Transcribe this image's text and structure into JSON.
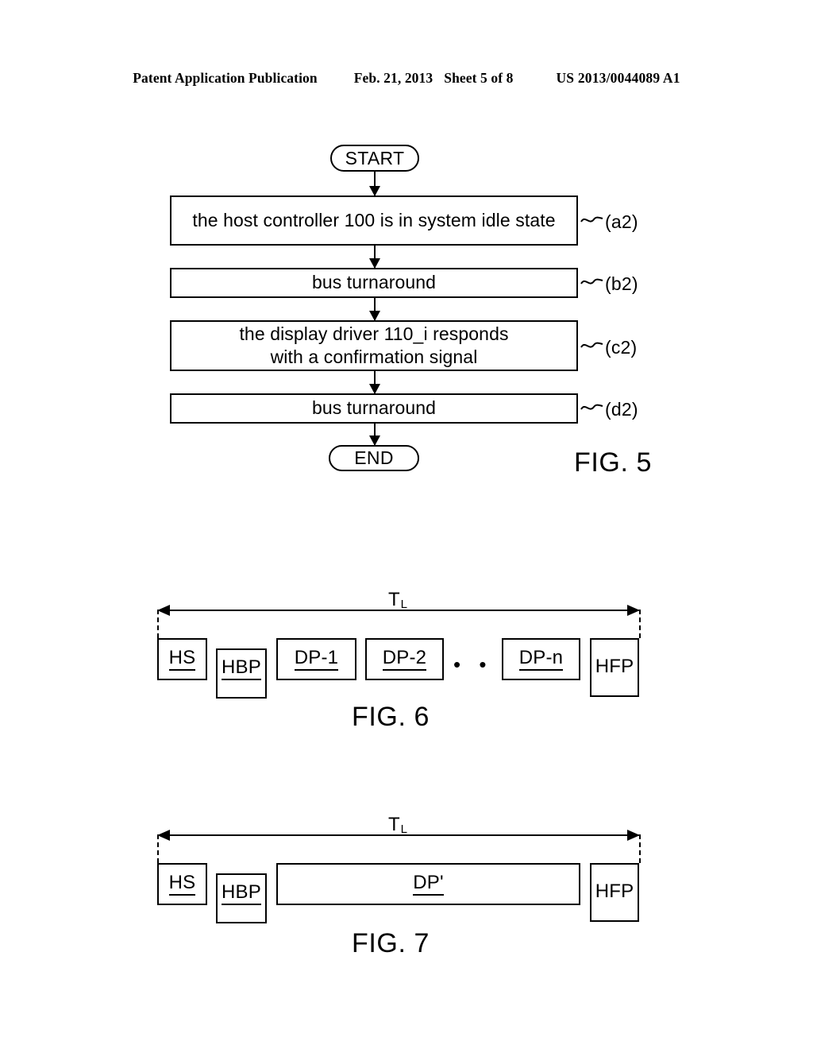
{
  "header": {
    "publication": "Patent Application Publication",
    "date": "Feb. 21, 2013",
    "sheet": "Sheet 5 of 8",
    "doc_number": "US 2013/0044089 A1"
  },
  "fig5": {
    "caption": "FIG. 5",
    "start_label": "START",
    "end_label": "END",
    "steps": [
      {
        "text": "the host controller 100 is in system idle state",
        "tag": "(a2)"
      },
      {
        "text": "bus turnaround",
        "tag": "(b2)"
      },
      {
        "text": "the display driver 110_i responds\nwith a confirmation signal",
        "tag": "(c2)"
      },
      {
        "text": "bus turnaround",
        "tag": "(d2)"
      }
    ]
  },
  "fig6": {
    "caption": "FIG. 6",
    "span_label": "T",
    "span_label_sub": "L",
    "ellipsis": "• • •",
    "slots": [
      {
        "label": "HS",
        "underlined": true
      },
      {
        "label": "HBP",
        "underlined": true
      },
      {
        "label": "DP-1",
        "underlined": true
      },
      {
        "label": "DP-2",
        "underlined": true
      },
      {
        "label": "DP-n",
        "underlined": true
      },
      {
        "label": "HFP",
        "underlined": false
      }
    ]
  },
  "fig7": {
    "caption": "FIG. 7",
    "span_label": "T",
    "span_label_sub": "L",
    "slots": [
      {
        "label": "HS",
        "underlined": true
      },
      {
        "label": "HBP",
        "underlined": true
      },
      {
        "label": "DP'",
        "underlined": true
      },
      {
        "label": "HFP",
        "underlined": false
      }
    ]
  },
  "colors": {
    "ink": "#000000",
    "paper": "#ffffff"
  }
}
